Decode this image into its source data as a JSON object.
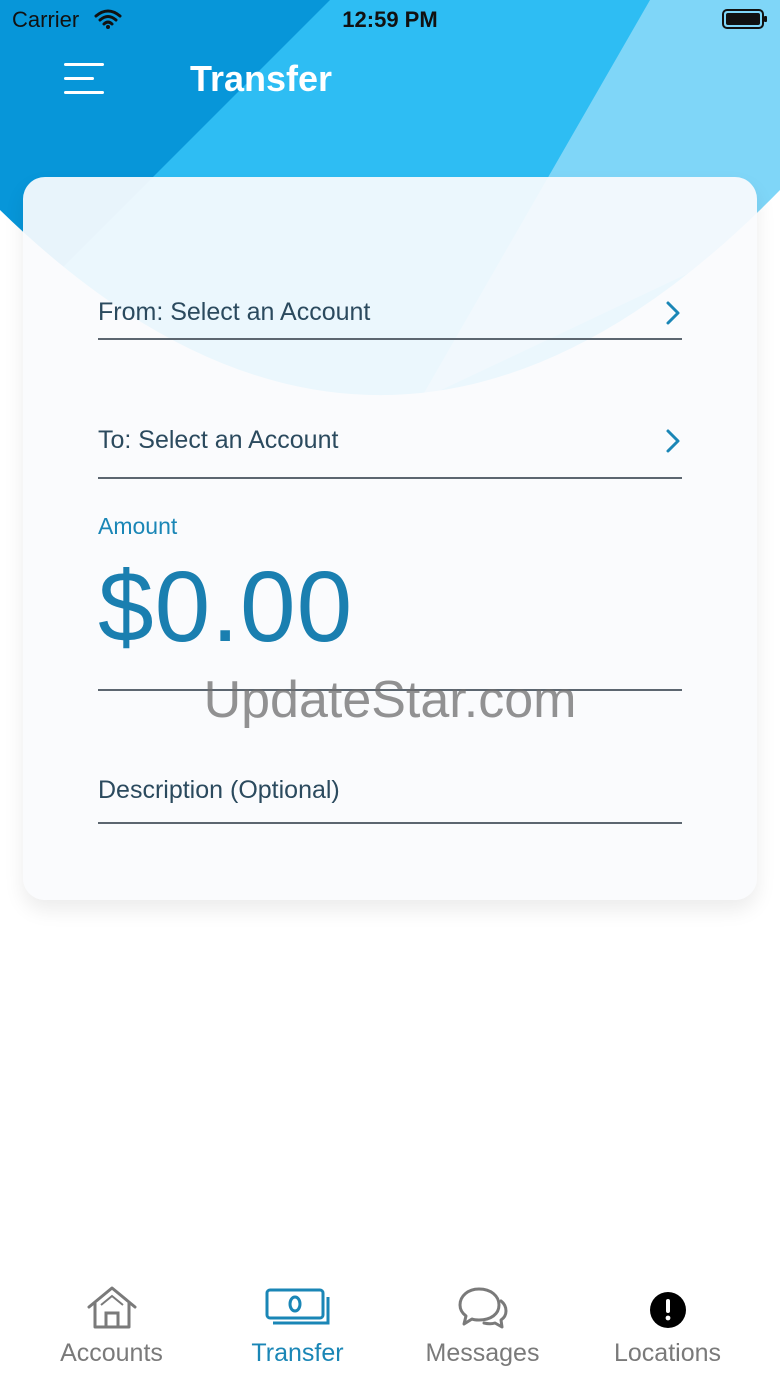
{
  "status_bar": {
    "carrier": "Carrier",
    "time": "12:59 PM"
  },
  "header": {
    "title": "Transfer",
    "menu_icon": "hamburger-menu-icon"
  },
  "form": {
    "from_label": "From: Select an Account",
    "to_label": "To: Select an Account",
    "amount_label": "Amount",
    "amount_value": "$0.00",
    "description_placeholder": "Description (Optional)",
    "chevron_icon": "chevron-right-icon"
  },
  "watermark": "UpdateStar.com",
  "tabs": [
    {
      "label": "Accounts",
      "icon": "home-icon",
      "active": false
    },
    {
      "label": "Transfer",
      "icon": "money-icon",
      "active": true
    },
    {
      "label": "Messages",
      "icon": "chat-bubbles-icon",
      "active": false
    },
    {
      "label": "Locations",
      "icon": "alert-circle-icon",
      "active": false
    }
  ],
  "colors": {
    "header_dark": "#0796d9",
    "header_mid": "#2ebdf3",
    "header_light": "#7fd6f8",
    "accent": "#1a86b6",
    "tab_inactive": "#7a7a7a"
  }
}
